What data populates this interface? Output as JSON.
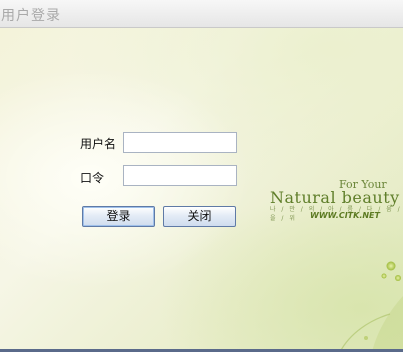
{
  "window": {
    "title": "用户登录"
  },
  "form": {
    "username_label": "用户名",
    "username_value": "",
    "password_label": "口令",
    "password_value": "",
    "login_button": "登录",
    "close_button": "关闭"
  },
  "branding": {
    "for_your": "For Your",
    "natural_beauty": "Natural beauty",
    "tagline_kr": "나 / 만 / 의 / 아 / 름 / 다 / 움 / 을 / 위",
    "url": "WWW.CITK.NET"
  },
  "colors": {
    "brand_green": "#5f7e2a",
    "button_border": "#5f7aa6"
  }
}
